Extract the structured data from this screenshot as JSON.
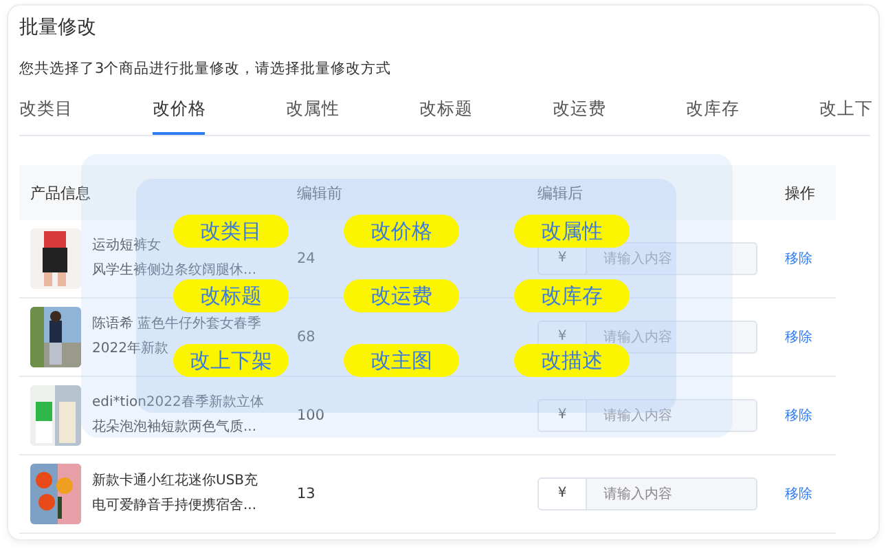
{
  "title": "批量修改",
  "subtitle": "您共选择了3个商品进行批量修改，请选择批量修改方式",
  "tabs": [
    {
      "label": "改类目",
      "selected": false
    },
    {
      "label": "改价格",
      "selected": true
    },
    {
      "label": "改属性",
      "selected": false
    },
    {
      "label": "改标题",
      "selected": false
    },
    {
      "label": "改运费",
      "selected": false
    },
    {
      "label": "改库存",
      "selected": false
    },
    {
      "label": "改上下",
      "selected": false
    }
  ],
  "table": {
    "columns": [
      "产品信息",
      "编辑前",
      "编辑后",
      "操作"
    ],
    "rows": [
      {
        "title_lines": [
          "运动短裤女",
          "风学生裤侧边条纹阔腿休..."
        ],
        "before": "24",
        "prefix": "¥",
        "placeholder": "请输入内容",
        "action": "移除"
      },
      {
        "title_lines": [
          "陈语希 蓝色牛仔外套女春季",
          "2022年新款"
        ],
        "before": "68",
        "prefix": "¥",
        "placeholder": "请输入内容",
        "action": "移除"
      },
      {
        "title_lines": [
          "edi*tion2022春季新款立体",
          "花朵泡泡袖短款两色气质..."
        ],
        "before": "100",
        "prefix": "¥",
        "placeholder": "请输入内容",
        "action": "移除"
      },
      {
        "title_lines": [
          "新款卡通小红花迷你USB充",
          "电可爱静音手持便携宿舍..."
        ],
        "before": "13",
        "prefix": "¥",
        "placeholder": "请输入内容",
        "action": "移除"
      }
    ]
  },
  "overlay": {
    "buttons": [
      "改类目",
      "改价格",
      "改属性",
      "改标题",
      "改运费",
      "改库存",
      "改上下架",
      "改主图",
      "改描述"
    ]
  }
}
